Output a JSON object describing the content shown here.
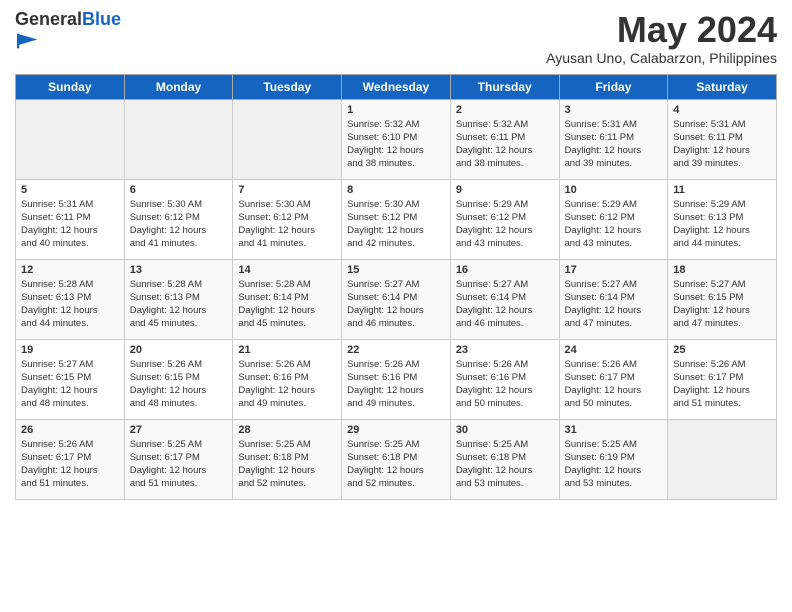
{
  "header": {
    "logo_general": "General",
    "logo_blue": "Blue",
    "month_title": "May 2024",
    "location": "Ayusan Uno, Calabarzon, Philippines"
  },
  "days_of_week": [
    "Sunday",
    "Monday",
    "Tuesday",
    "Wednesday",
    "Thursday",
    "Friday",
    "Saturday"
  ],
  "weeks": [
    [
      {
        "day": "",
        "info": ""
      },
      {
        "day": "",
        "info": ""
      },
      {
        "day": "",
        "info": ""
      },
      {
        "day": "1",
        "info": "Sunrise: 5:32 AM\nSunset: 6:10 PM\nDaylight: 12 hours\nand 38 minutes."
      },
      {
        "day": "2",
        "info": "Sunrise: 5:32 AM\nSunset: 6:11 PM\nDaylight: 12 hours\nand 38 minutes."
      },
      {
        "day": "3",
        "info": "Sunrise: 5:31 AM\nSunset: 6:11 PM\nDaylight: 12 hours\nand 39 minutes."
      },
      {
        "day": "4",
        "info": "Sunrise: 5:31 AM\nSunset: 6:11 PM\nDaylight: 12 hours\nand 39 minutes."
      }
    ],
    [
      {
        "day": "5",
        "info": "Sunrise: 5:31 AM\nSunset: 6:11 PM\nDaylight: 12 hours\nand 40 minutes."
      },
      {
        "day": "6",
        "info": "Sunrise: 5:30 AM\nSunset: 6:12 PM\nDaylight: 12 hours\nand 41 minutes."
      },
      {
        "day": "7",
        "info": "Sunrise: 5:30 AM\nSunset: 6:12 PM\nDaylight: 12 hours\nand 41 minutes."
      },
      {
        "day": "8",
        "info": "Sunrise: 5:30 AM\nSunset: 6:12 PM\nDaylight: 12 hours\nand 42 minutes."
      },
      {
        "day": "9",
        "info": "Sunrise: 5:29 AM\nSunset: 6:12 PM\nDaylight: 12 hours\nand 43 minutes."
      },
      {
        "day": "10",
        "info": "Sunrise: 5:29 AM\nSunset: 6:12 PM\nDaylight: 12 hours\nand 43 minutes."
      },
      {
        "day": "11",
        "info": "Sunrise: 5:29 AM\nSunset: 6:13 PM\nDaylight: 12 hours\nand 44 minutes."
      }
    ],
    [
      {
        "day": "12",
        "info": "Sunrise: 5:28 AM\nSunset: 6:13 PM\nDaylight: 12 hours\nand 44 minutes."
      },
      {
        "day": "13",
        "info": "Sunrise: 5:28 AM\nSunset: 6:13 PM\nDaylight: 12 hours\nand 45 minutes."
      },
      {
        "day": "14",
        "info": "Sunrise: 5:28 AM\nSunset: 6:14 PM\nDaylight: 12 hours\nand 45 minutes."
      },
      {
        "day": "15",
        "info": "Sunrise: 5:27 AM\nSunset: 6:14 PM\nDaylight: 12 hours\nand 46 minutes."
      },
      {
        "day": "16",
        "info": "Sunrise: 5:27 AM\nSunset: 6:14 PM\nDaylight: 12 hours\nand 46 minutes."
      },
      {
        "day": "17",
        "info": "Sunrise: 5:27 AM\nSunset: 6:14 PM\nDaylight: 12 hours\nand 47 minutes."
      },
      {
        "day": "18",
        "info": "Sunrise: 5:27 AM\nSunset: 6:15 PM\nDaylight: 12 hours\nand 47 minutes."
      }
    ],
    [
      {
        "day": "19",
        "info": "Sunrise: 5:27 AM\nSunset: 6:15 PM\nDaylight: 12 hours\nand 48 minutes."
      },
      {
        "day": "20",
        "info": "Sunrise: 5:26 AM\nSunset: 6:15 PM\nDaylight: 12 hours\nand 48 minutes."
      },
      {
        "day": "21",
        "info": "Sunrise: 5:26 AM\nSunset: 6:16 PM\nDaylight: 12 hours\nand 49 minutes."
      },
      {
        "day": "22",
        "info": "Sunrise: 5:26 AM\nSunset: 6:16 PM\nDaylight: 12 hours\nand 49 minutes."
      },
      {
        "day": "23",
        "info": "Sunrise: 5:26 AM\nSunset: 6:16 PM\nDaylight: 12 hours\nand 50 minutes."
      },
      {
        "day": "24",
        "info": "Sunrise: 5:26 AM\nSunset: 6:17 PM\nDaylight: 12 hours\nand 50 minutes."
      },
      {
        "day": "25",
        "info": "Sunrise: 5:26 AM\nSunset: 6:17 PM\nDaylight: 12 hours\nand 51 minutes."
      }
    ],
    [
      {
        "day": "26",
        "info": "Sunrise: 5:26 AM\nSunset: 6:17 PM\nDaylight: 12 hours\nand 51 minutes."
      },
      {
        "day": "27",
        "info": "Sunrise: 5:25 AM\nSunset: 6:17 PM\nDaylight: 12 hours\nand 51 minutes."
      },
      {
        "day": "28",
        "info": "Sunrise: 5:25 AM\nSunset: 6:18 PM\nDaylight: 12 hours\nand 52 minutes."
      },
      {
        "day": "29",
        "info": "Sunrise: 5:25 AM\nSunset: 6:18 PM\nDaylight: 12 hours\nand 52 minutes."
      },
      {
        "day": "30",
        "info": "Sunrise: 5:25 AM\nSunset: 6:18 PM\nDaylight: 12 hours\nand 53 minutes."
      },
      {
        "day": "31",
        "info": "Sunrise: 5:25 AM\nSunset: 6:19 PM\nDaylight: 12 hours\nand 53 minutes."
      },
      {
        "day": "",
        "info": ""
      }
    ]
  ]
}
